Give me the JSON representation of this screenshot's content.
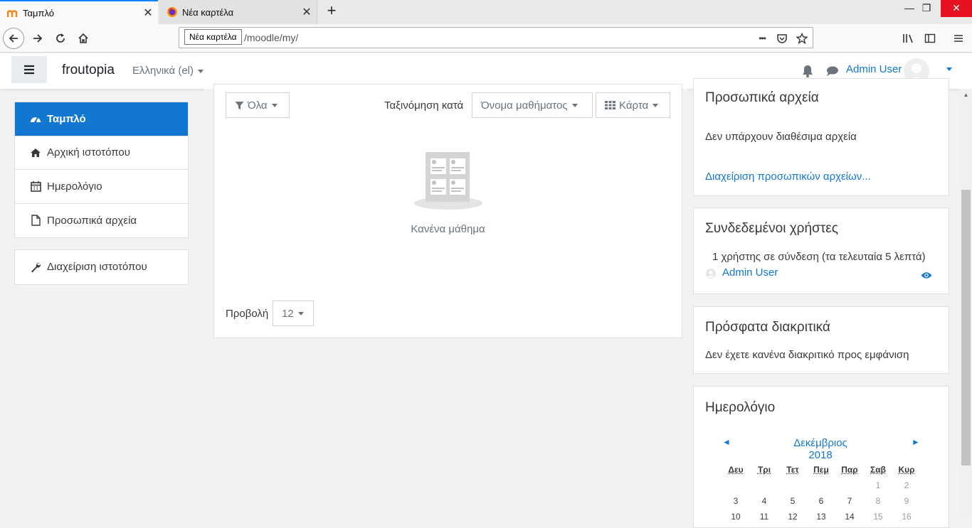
{
  "browser": {
    "tabs": [
      {
        "title": "Ταμπλό",
        "active": true
      },
      {
        "title": "Νέα καρτέλα",
        "active": false
      }
    ],
    "tooltip": "Νέα καρτέλα",
    "url": "/moodle/my/",
    "url_menu": "•••"
  },
  "header": {
    "site_name": "froutopia",
    "language": "Ελληνικά (el)",
    "user_name": "Admin User"
  },
  "nav": {
    "items": [
      {
        "label": "Ταμπλό",
        "icon": "dashboard-icon"
      },
      {
        "label": "Αρχική ιστοτόπου",
        "icon": "home-icon"
      },
      {
        "label": "Ημερολόγιο",
        "icon": "calendar-icon"
      },
      {
        "label": "Προσωπικά αρχεία",
        "icon": "file-icon"
      }
    ],
    "admin_item": {
      "label": "Διαχείριση ιστοτόπου",
      "icon": "wrench-icon"
    }
  },
  "courses": {
    "filter_label": "Όλα",
    "sort_prefix": "Ταξινόμηση κατά",
    "sort_value": "Όνομα μαθήματος",
    "view_label": "Κάρτα",
    "empty_text": "Κανένα μάθημα",
    "show_label": "Προβολή",
    "show_value": "12"
  },
  "blocks": {
    "private_files": {
      "title": "Προσωπικά αρχεία",
      "empty": "Δεν υπάρχουν διαθέσιμα αρχεία",
      "manage_link": "Διαχείριση προσωπικών αρχείων..."
    },
    "online_users": {
      "title": "Συνδεδεμένοι χρήστες",
      "summary": "1 χρήστης σε σύνδεση (τα τελευταία 5 λεπτά)",
      "user": "Admin User"
    },
    "badges": {
      "title": "Πρόσφατα διακριτικά",
      "empty": "Δεν έχετε κανένα διακριτικό προς εμφάνιση"
    },
    "calendar": {
      "title": "Ημερολόγιο",
      "prev": "◄",
      "next": "►",
      "month": "Δεκέμβριος 2018",
      "weekdays": [
        "Δευ",
        "Τρι",
        "Τετ",
        "Πεμ",
        "Παρ",
        "Σαβ",
        "Κυρ"
      ],
      "weeks": [
        [
          "",
          "",
          "",
          "",
          "",
          "1",
          "2"
        ],
        [
          "3",
          "4",
          "5",
          "6",
          "7",
          "8",
          "9"
        ],
        [
          "10",
          "11",
          "12",
          "13",
          "14",
          "15",
          "16"
        ]
      ]
    }
  },
  "colors": {
    "accent": "#1177d1",
    "firefox_tab_line": "#0a84ff"
  }
}
